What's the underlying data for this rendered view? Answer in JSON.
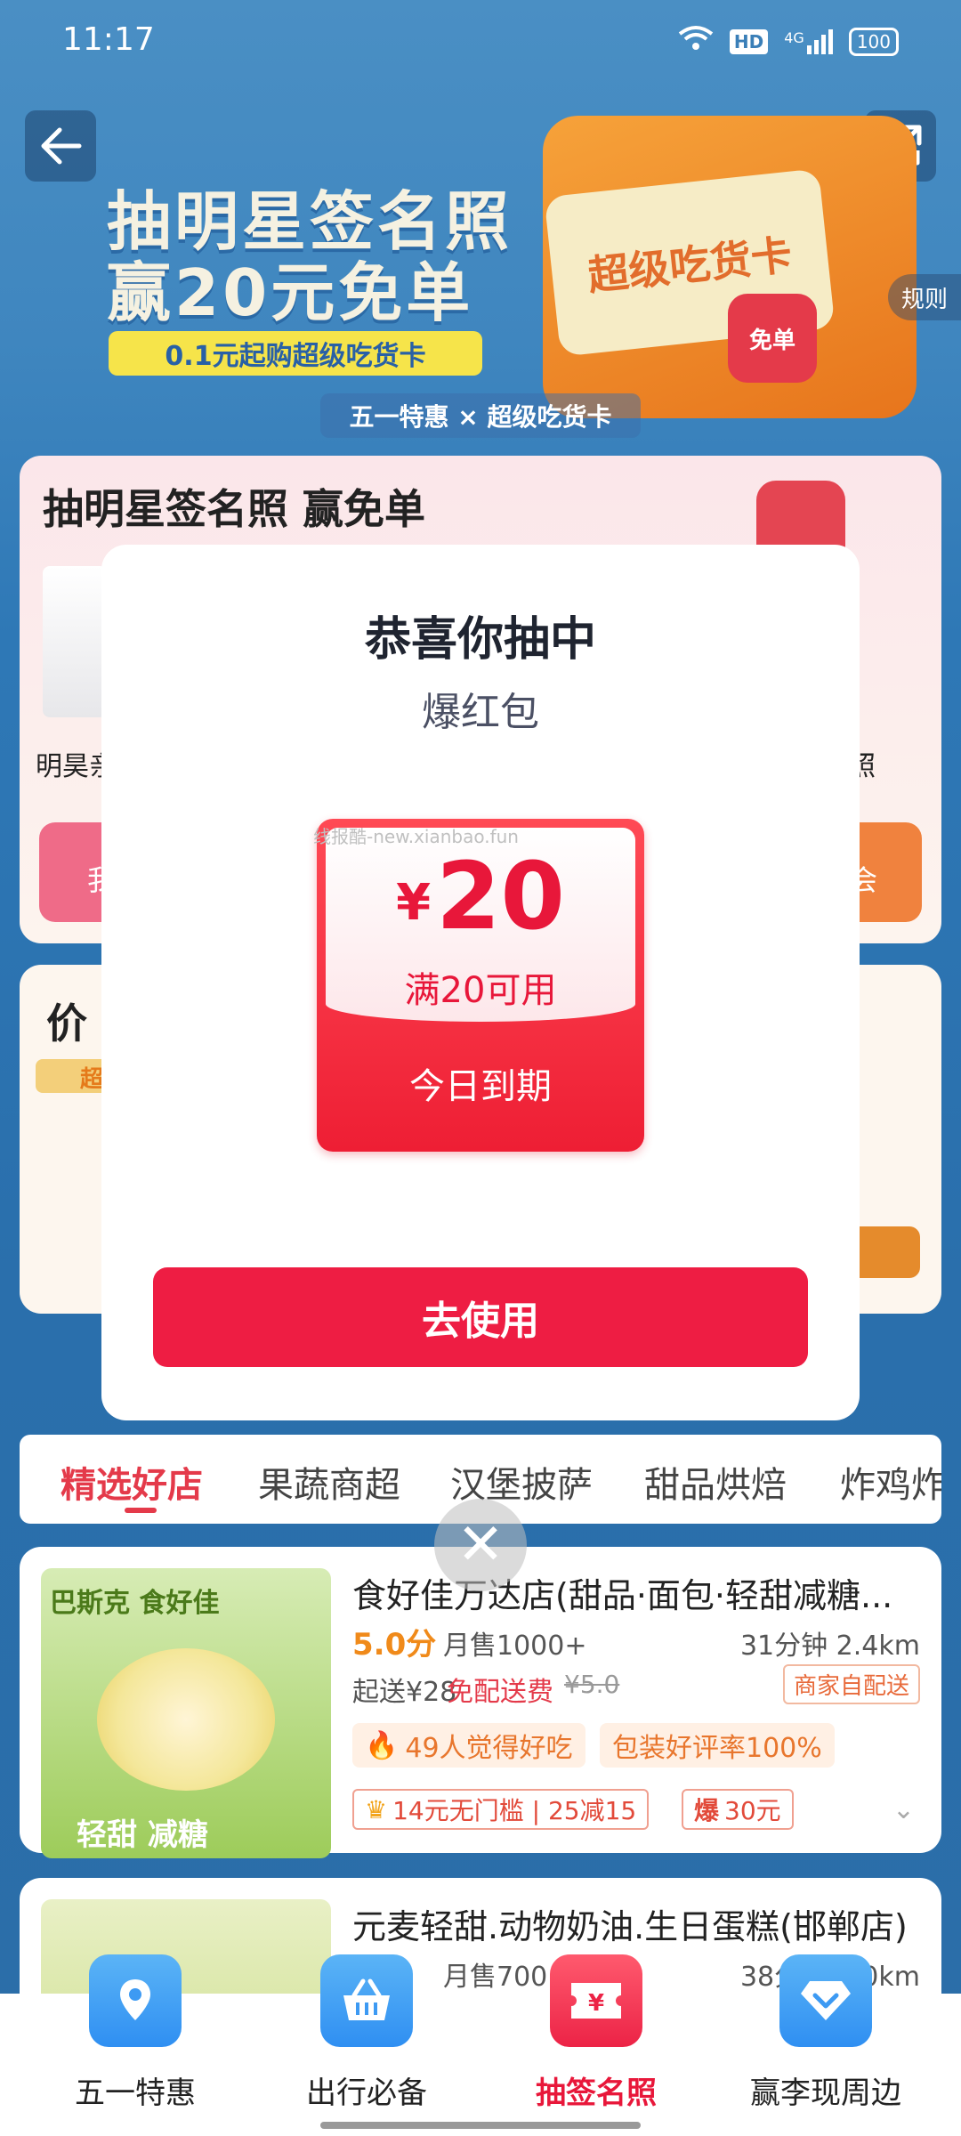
{
  "status_bar": {
    "time": "11:17",
    "hd": "HD",
    "network": "4G",
    "battery": "100"
  },
  "banner": {
    "title_line1": "抽明星签名照",
    "title_line2": "赢20元免单",
    "pill": "0.1元起购超级吃货卡",
    "card_text": "超级吃货卡",
    "free_tag": "免单",
    "rules": "规则",
    "co_brand": "五一特惠 × 超级吃货卡"
  },
  "activity_card": {
    "title": "抽明星签名照 赢免单",
    "left_person_label": "明昊亲",
    "right_label": "照",
    "left_btn": "我",
    "right_btn": "会"
  },
  "price_card": {
    "title": "价",
    "badge": "超"
  },
  "modal": {
    "title": "恭喜你抽中",
    "subtitle": "爆红包",
    "coupon": {
      "currency": "¥",
      "amount": "20",
      "condition": "满20可用",
      "expire": "今日到期"
    },
    "watermark": "线报酷-new.xianbao.fun",
    "use_button": "去使用",
    "close_symbol": "✕"
  },
  "tabs": [
    "精选好店",
    "果蔬商超",
    "汉堡披萨",
    "甜品烘焙",
    "炸鸡炸"
  ],
  "stores": [
    {
      "name": "食好佳万达店(甜品·面包·轻甜减糖...",
      "score": "5.0分",
      "sales": "月售1000+",
      "distance": "31分钟 2.4km",
      "min_order": "起送¥28",
      "free_delivery": "免配送费",
      "old_fee": "¥5.0",
      "delivery_tag": "商家自配送",
      "hot_tag": "49人觉得好吃",
      "rate_tag": "包装好评率100%",
      "coupon_a": "14元无门槛 | 25减15",
      "coupon_b_prefix": "爆",
      "coupon_b": "30元",
      "img_text": "巴斯克 食好佳",
      "img_text2": "轻甜 减糖"
    },
    {
      "name": "元麦轻甜.动物奶油.生日蛋糕(邯郸店)",
      "sales": "月售700+",
      "distance": "38分钟 3.0km"
    }
  ],
  "bottom_nav": [
    {
      "label": "五一特惠",
      "icon": "map-pin-icon"
    },
    {
      "label": "出行必备",
      "icon": "basket-icon"
    },
    {
      "label": "抽签名照",
      "icon": "ticket-yen-icon",
      "active": true
    },
    {
      "label": "赢李现周边",
      "icon": "diamond-icon"
    }
  ],
  "colors": {
    "accent": "#ee1d43",
    "nav_blue": "#2f8ff2"
  }
}
